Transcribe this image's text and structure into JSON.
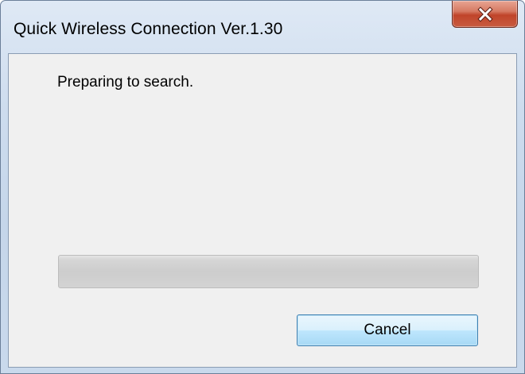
{
  "window": {
    "title": "Quick Wireless Connection Ver.1.30"
  },
  "titlebar": {
    "close_icon": "close-icon"
  },
  "content": {
    "status_text": "Preparing to search."
  },
  "progress": {
    "value_percent": 0
  },
  "buttons": {
    "cancel_label": "Cancel"
  },
  "colors": {
    "close_button": "#c8452a",
    "dialog_background": "#f0f0f0",
    "button_border": "#3c7fb1"
  }
}
